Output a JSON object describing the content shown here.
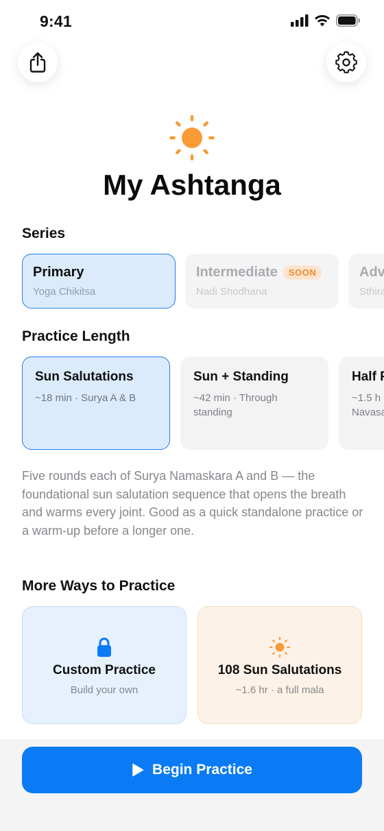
{
  "status": {
    "time": "9:41"
  },
  "header": {
    "title": "My Ashtanga"
  },
  "series": {
    "label": "Series",
    "items": [
      {
        "name": "Primary",
        "subtitle": "Yoga Chikitsa",
        "badge": ""
      },
      {
        "name": "Intermediate",
        "subtitle": "Nadi Shodhana",
        "badge": "SOON"
      },
      {
        "name": "Adv",
        "subtitle": "Sthira",
        "badge": ""
      }
    ]
  },
  "practice_length": {
    "label": "Practice Length",
    "items": [
      {
        "name": "Sun Salutations",
        "detail": "~18 min · Surya A & B"
      },
      {
        "name": "Sun + Standing",
        "detail": "~42 min · Through standing"
      },
      {
        "name": "Half P",
        "detail": "~1.5 h Navasa"
      }
    ],
    "description": "Five rounds each of Surya Namaskara A and B — the foundational sun salutation sequence that opens the breath and warms every joint. Good as a quick standalone practice or a warm-up before a longer one."
  },
  "more_ways": {
    "label": "More Ways to Practice",
    "items": [
      {
        "title": "Custom Practice",
        "subtitle": "Build your own",
        "icon": "lock-icon"
      },
      {
        "title": "108 Sun Salutations",
        "subtitle": "~1.6 hr · a full mala",
        "icon": "sun-icon"
      }
    ]
  },
  "cta": {
    "label": "Begin Practice",
    "icon": "play-icon"
  },
  "colors": {
    "accent": "#0a7bf4",
    "sun": "#f99a36",
    "selected_bg": "#dcebfb"
  }
}
